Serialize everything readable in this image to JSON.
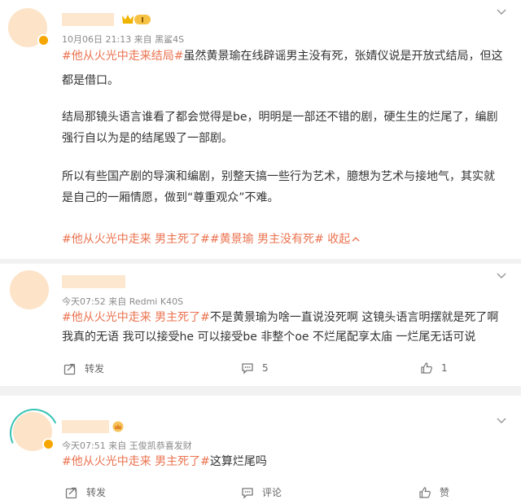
{
  "posts": [
    {
      "meta": "10月06日 21:13  来自 黑鲨4S",
      "paragraphs": [
        {
          "tag": "#他从火光中走来结局#",
          "text": "虽然黄景瑜在线辟谣男主没有死，张婧仪说是开放式结局，但这"
        },
        {
          "tag": "",
          "text": "都是借口。"
        },
        {
          "tag": "",
          "text": "结局那镜头语言谁看了都会觉得是be，明明是一部还不错的剧，硬生生的烂尾了，编剧"
        },
        {
          "tag": "",
          "text": "强行自以为是的结尾毁了一部剧。"
        },
        {
          "tag": "",
          "text": "所以有些国产剧的导演和编剧，别整天搞一些行为艺术，臆想为艺术与接地气，其实就"
        },
        {
          "tag": "",
          "text": "是自己的一厢情愿，做到“尊重观众”不难。"
        }
      ],
      "tags_line": "#他从火光中走来 男主死了##黄景瑜 男主没有死#",
      "collapse_label": "收起",
      "badge_label": "I"
    },
    {
      "meta": "今天07:52  来自 Redmi K40S",
      "lines": [
        {
          "tag": "#他从火光中走来 男主死了#",
          "text": "不是黄景瑜为啥一直说没死啊 这镜头语言明摆就是死了啊"
        },
        {
          "tag": "",
          "text": "我真的无语 我可以接受he 可以接受be 非整个oe 不烂尾配享太庙 一烂尾无话可说"
        }
      ],
      "repost_label": "转发",
      "comment_count": "5",
      "like_count": "1"
    },
    {
      "meta": "今天07:51  来自 王俊凯恭喜发财",
      "lines": [
        {
          "tag": "#他从火光中走来 男主死了#",
          "text": "这算烂尾吗"
        }
      ],
      "repost_label": "转发",
      "comment_label": "评论",
      "like_label": "赞"
    }
  ],
  "colors": {
    "tag": "#eb7350",
    "avatar": "#fde3c8",
    "separator": "#f2f2f2"
  }
}
